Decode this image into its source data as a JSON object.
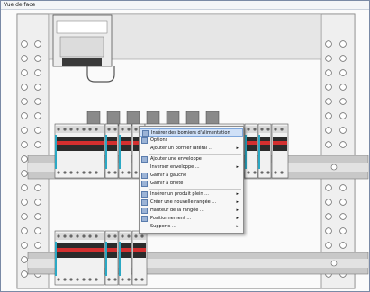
{
  "window": {
    "title": "Vue de face"
  },
  "context_menu": {
    "items": [
      {
        "label": "Insérer des borniers d'alimentation",
        "icon": "bornier-icon",
        "submenu": false,
        "highlighted": true
      },
      {
        "label": "Options",
        "icon": "options-icon",
        "submenu": false,
        "highlighted": false
      },
      {
        "label": "Ajouter un bornier latéral ...",
        "icon": "blank-icon",
        "submenu": true,
        "highlighted": false
      },
      {
        "label": "Ajouter une enveloppe",
        "icon": "envelope-icon",
        "submenu": false,
        "highlighted": false
      },
      {
        "label": "Inverser enveloppe ...",
        "icon": "blank-icon",
        "submenu": true,
        "highlighted": false
      },
      {
        "label": "Garnir à gauche",
        "icon": "left-icon",
        "submenu": false,
        "highlighted": false
      },
      {
        "label": "Garnir à droite",
        "icon": "right-icon",
        "submenu": false,
        "highlighted": false
      },
      {
        "label": "Insérer un produit plein ...",
        "icon": "product-icon",
        "submenu": true,
        "highlighted": false
      },
      {
        "label": "Créer une nouvelle rangée ...",
        "icon": "row-icon",
        "submenu": true,
        "highlighted": false
      },
      {
        "label": "Hauteur de la rangée ...",
        "icon": "height-icon",
        "submenu": true,
        "highlighted": false
      },
      {
        "label": "Positionnement ...",
        "icon": "position-icon",
        "submenu": true,
        "highlighted": false
      },
      {
        "label": "Supports ...",
        "icon": "blank-icon",
        "submenu": true,
        "highlighted": false
      }
    ]
  },
  "colors": {
    "accent_highlight": "#cfe0f7",
    "breaker_red": "#d32f2f",
    "breaker_dark": "#2b2b2b",
    "rail": "#9a9a9a",
    "cyan_module": "#2aa8c4"
  }
}
